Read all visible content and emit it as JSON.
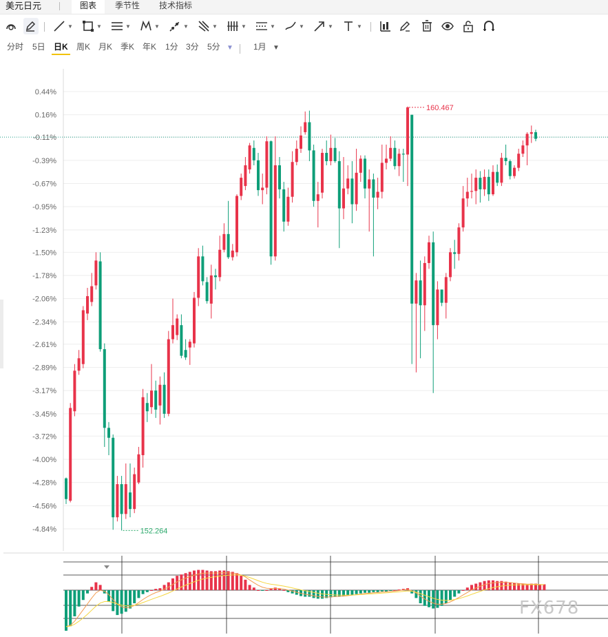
{
  "tabbar": {
    "title": "美元日元",
    "tabs": [
      {
        "label": "图表",
        "active": true
      },
      {
        "label": "季节性",
        "active": false
      },
      {
        "label": "技术指标",
        "active": false
      }
    ]
  },
  "toolbar": {
    "tools": [
      {
        "name": "magnet-icon",
        "caret": false
      },
      {
        "name": "pencil-icon",
        "caret": false,
        "active": true
      },
      {
        "name": "trend-line-icon",
        "caret": true
      },
      {
        "name": "rectangle-icon",
        "caret": true
      },
      {
        "name": "channel-icon",
        "caret": true
      },
      {
        "name": "pattern-icon",
        "caret": true
      },
      {
        "name": "ray-icon",
        "caret": true
      },
      {
        "name": "fork-icon",
        "caret": true
      },
      {
        "name": "bars-icon",
        "caret": true
      },
      {
        "name": "levels-icon",
        "caret": true
      },
      {
        "name": "brush-icon",
        "caret": true
      },
      {
        "name": "arrow-icon",
        "caret": true
      },
      {
        "name": "text-icon",
        "caret": true
      },
      {
        "name": "chart-icon",
        "caret": false
      },
      {
        "name": "edit-icon",
        "caret": false
      },
      {
        "name": "trash-icon",
        "caret": false
      },
      {
        "name": "eye-icon",
        "caret": false
      },
      {
        "name": "lock-icon",
        "caret": false
      },
      {
        "name": "magnet-u-icon",
        "caret": false
      }
    ]
  },
  "periods": {
    "items": [
      "分时",
      "5日",
      "日K",
      "周K",
      "月K",
      "季K",
      "年K",
      "1分",
      "3分",
      "5分"
    ],
    "active": "日K",
    "more_caret": "▼",
    "range_label": "1月",
    "range_caret": "▼"
  },
  "colors": {
    "up": "#e8334a",
    "down": "#0e9e78",
    "grid": "#eeeeee",
    "axis_text": "#666666",
    "last_price_line": "#1e9e86",
    "high_label": "#e8334a",
    "low_label": "#2aa86a",
    "macd_dif": "#f39c50",
    "macd_dea": "#f5d640"
  },
  "watermark": "FX678",
  "chart_data": {
    "type": "candlestick",
    "yaxis": {
      "unit": "%",
      "ticks": [
        "0.44%",
        "0.16%",
        "-0.11%",
        "-0.39%",
        "-0.67%",
        "-0.95%",
        "-1.23%",
        "-1.50%",
        "-1.78%",
        "-2.06%",
        "-2.34%",
        "-2.61%",
        "-2.89%",
        "-3.17%",
        "-3.45%",
        "-3.72%",
        "-4.00%",
        "-4.28%",
        "-4.56%",
        "-4.84%"
      ],
      "range": [
        -5.0,
        0.62
      ]
    },
    "last_value": -0.11,
    "annotations": {
      "high": {
        "label": "160.467",
        "value": 0.25,
        "index": 80
      },
      "low": {
        "label": "152.264",
        "value": -4.86,
        "index": 13
      }
    },
    "candles": [
      [
        -4.23,
        -4.48,
        -4.22,
        -4.54
      ],
      [
        -4.5,
        -3.38,
        -3.32,
        -4.52
      ],
      [
        -3.42,
        -2.93,
        -2.85,
        -3.48
      ],
      [
        -2.93,
        -2.78,
        -2.68,
        -2.98
      ],
      [
        -2.85,
        -2.2,
        -2.15,
        -2.9
      ],
      [
        -2.24,
        -2.03,
        -1.93,
        -2.32
      ],
      [
        -2.1,
        -1.91,
        -1.75,
        -2.15
      ],
      [
        -1.9,
        -1.6,
        -1.5,
        -1.95
      ],
      [
        -1.61,
        -2.67,
        -1.5,
        -2.7
      ],
      [
        -2.67,
        -3.62,
        -2.6,
        -3.85
      ],
      [
        -3.62,
        -3.74,
        -3.55,
        -3.95
      ],
      [
        -3.74,
        -4.7,
        -3.7,
        -4.85
      ],
      [
        -4.7,
        -4.3,
        -4.2,
        -4.75
      ],
      [
        -4.3,
        -4.66,
        -4.2,
        -4.86
      ],
      [
        -4.66,
        -4.3,
        -4.05,
        -4.72
      ],
      [
        -4.4,
        -4.6,
        -4.05,
        -4.7
      ],
      [
        -4.6,
        -4.18,
        -4.1,
        -4.65
      ],
      [
        -4.28,
        -3.94,
        -3.85,
        -4.3
      ],
      [
        -3.95,
        -3.25,
        -3.15,
        -4.1
      ],
      [
        -3.32,
        -3.42,
        -3.2,
        -3.55
      ],
      [
        -3.37,
        -3.17,
        -2.85,
        -3.45
      ],
      [
        -3.17,
        -3.4,
        -3.05,
        -3.5
      ],
      [
        -3.35,
        -3.1,
        -3.0,
        -3.58
      ],
      [
        -3.1,
        -3.45,
        -2.95,
        -3.5
      ],
      [
        -3.45,
        -2.55,
        -2.45,
        -3.48
      ],
      [
        -2.55,
        -2.38,
        -2.06,
        -2.6
      ],
      [
        -2.5,
        -2.3,
        -2.25,
        -2.56
      ],
      [
        -2.38,
        -2.75,
        -2.25,
        -2.78
      ],
      [
        -2.68,
        -2.77,
        -2.55,
        -2.8
      ],
      [
        -2.65,
        -2.58,
        -2.55,
        -2.86
      ],
      [
        -2.6,
        -2.05,
        -1.98,
        -2.65
      ],
      [
        -2.05,
        -1.55,
        -1.45,
        -2.15
      ],
      [
        -1.55,
        -1.85,
        -1.42,
        -1.9
      ],
      [
        -1.86,
        -2.09,
        -1.8,
        -2.12
      ],
      [
        -2.12,
        -1.78,
        -1.65,
        -2.3
      ],
      [
        -1.78,
        -1.8,
        -1.7,
        -1.95
      ],
      [
        -1.8,
        -1.47,
        -1.3,
        -1.85
      ],
      [
        -1.47,
        -1.28,
        -1.15,
        -1.5
      ],
      [
        -1.28,
        -1.56,
        -0.88,
        -1.58
      ],
      [
        -1.56,
        -1.48,
        -1.4,
        -1.6
      ],
      [
        -1.5,
        -0.82,
        -0.8,
        -1.55
      ],
      [
        -0.82,
        -0.6,
        -0.55,
        -0.87
      ],
      [
        -0.7,
        -0.45,
        -0.35,
        -0.75
      ],
      [
        -0.5,
        -0.21,
        -0.18,
        -0.55
      ],
      [
        -0.24,
        -0.39,
        -0.15,
        -0.45
      ],
      [
        -0.39,
        -0.75,
        -0.3,
        -0.82
      ],
      [
        -0.75,
        -0.72,
        -0.55,
        -0.92
      ],
      [
        -0.72,
        -0.16,
        -0.1,
        -0.8
      ],
      [
        -0.16,
        -1.55,
        -0.15,
        -1.65
      ],
      [
        -1.55,
        -0.45,
        -0.1,
        -1.6
      ],
      [
        -0.45,
        -0.74,
        -0.35,
        -0.85
      ],
      [
        -0.74,
        -1.13,
        -0.65,
        -1.25
      ],
      [
        -1.13,
        -0.83,
        -0.72,
        -1.18
      ],
      [
        -0.83,
        -0.41,
        -0.28,
        -0.9
      ],
      [
        -0.41,
        -0.25,
        -0.15,
        -0.45
      ],
      [
        -0.25,
        -0.09,
        0.02,
        -0.3
      ],
      [
        -0.05,
        0.07,
        0.2,
        -0.08
      ],
      [
        0.07,
        -0.27,
        0.21,
        -0.4
      ],
      [
        -0.27,
        -0.88,
        -0.2,
        -0.95
      ],
      [
        -0.88,
        -0.8,
        -0.65,
        -1.2
      ],
      [
        -0.78,
        -0.3,
        -0.25,
        -0.85
      ],
      [
        -0.3,
        -0.4,
        -0.15,
        -0.45
      ],
      [
        -0.4,
        -0.24,
        -0.08,
        -0.45
      ],
      [
        -0.24,
        -0.4,
        -0.12,
        -0.42
      ],
      [
        -0.4,
        -0.97,
        -0.28,
        -1.45
      ],
      [
        -0.97,
        -0.73,
        -0.35,
        -1.1
      ],
      [
        -0.73,
        -0.61,
        -0.45,
        -0.8
      ],
      [
        -0.61,
        -0.92,
        -0.4,
        -1.15
      ],
      [
        -0.92,
        -0.54,
        -0.25,
        -1.0
      ],
      [
        -0.54,
        -0.37,
        -0.33,
        -0.65
      ],
      [
        -0.37,
        -0.73,
        -0.33,
        -0.85
      ],
      [
        -0.73,
        -0.62,
        -0.5,
        -1.25
      ],
      [
        -0.62,
        -0.84,
        -0.55,
        -1.55
      ],
      [
        -0.84,
        -0.77,
        -0.6,
        -0.98
      ],
      [
        -0.77,
        -0.42,
        -0.2,
        -0.85
      ],
      [
        -0.42,
        -0.37,
        -0.2,
        -0.5
      ],
      [
        -0.37,
        -0.24,
        -0.1,
        -0.4
      ],
      [
        -0.24,
        -0.46,
        -0.15,
        -0.5
      ],
      [
        -0.46,
        -0.31,
        -0.25,
        -0.58
      ],
      [
        -0.31,
        -0.32,
        -0.25,
        -0.65
      ],
      [
        -0.32,
        0.25,
        0.26,
        -0.7
      ],
      [
        0.16,
        -2.12,
        0.16,
        -2.85
      ],
      [
        -2.12,
        -1.84,
        -1.75,
        -2.95
      ],
      [
        -1.84,
        -2.14,
        -1.6,
        -2.78
      ],
      [
        -2.14,
        -1.63,
        -1.55,
        -2.45
      ],
      [
        -1.63,
        -1.38,
        -1.3,
        -1.7
      ],
      [
        -1.38,
        -2.38,
        -1.25,
        -3.2
      ],
      [
        -2.38,
        -1.95,
        -1.85,
        -2.55
      ],
      [
        -1.95,
        -2.11,
        -1.95,
        -2.15
      ],
      [
        -2.11,
        -1.8,
        -1.75,
        -2.3
      ],
      [
        -1.8,
        -1.5,
        -1.45,
        -1.85
      ],
      [
        -1.5,
        -1.52,
        -1.35,
        -1.7
      ],
      [
        -1.52,
        -1.2,
        -1.15,
        -1.6
      ],
      [
        -1.2,
        -0.85,
        -0.7,
        -1.25
      ],
      [
        -0.85,
        -0.77,
        -0.6,
        -0.95
      ],
      [
        -0.77,
        -0.76,
        -0.55,
        -0.85
      ],
      [
        -0.76,
        -0.6,
        -0.5,
        -0.92
      ],
      [
        -0.6,
        -0.74,
        -0.52,
        -0.9
      ],
      [
        -0.74,
        -0.59,
        -0.5,
        -0.82
      ],
      [
        -0.59,
        -0.8,
        -0.5,
        -0.88
      ],
      [
        -0.8,
        -0.53,
        -0.45,
        -0.82
      ],
      [
        -0.53,
        -0.66,
        -0.44,
        -0.7
      ],
      [
        -0.66,
        -0.36,
        -0.3,
        -0.7
      ],
      [
        -0.36,
        -0.4,
        -0.2,
        -0.45
      ],
      [
        -0.4,
        -0.58,
        -0.38,
        -0.62
      ],
      [
        -0.58,
        -0.48,
        -0.45,
        -0.61
      ],
      [
        -0.48,
        -0.31,
        -0.25,
        -0.52
      ],
      [
        -0.31,
        -0.21,
        -0.15,
        -0.35
      ],
      [
        -0.21,
        -0.07,
        -0.05,
        -0.45
      ],
      [
        -0.07,
        -0.05,
        0.03,
        -0.18
      ],
      [
        -0.05,
        -0.13,
        -0.02,
        -0.16
      ]
    ],
    "macd": [
      -0.62,
      -0.55,
      -0.4,
      -0.25,
      -0.15,
      -0.05,
      0.05,
      0.12,
      0.08,
      -0.05,
      -0.18,
      -0.32,
      -0.38,
      -0.36,
      -0.33,
      -0.28,
      -0.2,
      -0.12,
      -0.06,
      -0.03,
      0.0,
      0.02,
      0.03,
      0.08,
      0.12,
      0.18,
      0.22,
      0.24,
      0.26,
      0.28,
      0.3,
      0.31,
      0.31,
      0.3,
      0.29,
      0.29,
      0.3,
      0.3,
      0.29,
      0.28,
      0.26,
      0.22,
      0.16,
      0.08,
      0.04,
      0.0,
      -0.01,
      0.0,
      0.02,
      0.04,
      0.02,
      0.0,
      -0.03,
      -0.05,
      -0.07,
      -0.09,
      -0.1,
      -0.1,
      -0.12,
      -0.13,
      -0.13,
      -0.12,
      -0.11,
      -0.1,
      -0.1,
      -0.09,
      -0.08,
      -0.07,
      -0.06,
      -0.05,
      -0.04,
      -0.04,
      -0.03,
      -0.03,
      -0.02,
      -0.02,
      -0.01,
      0.0,
      0.01,
      0.02,
      0.03,
      -0.05,
      -0.12,
      -0.2,
      -0.24,
      -0.26,
      -0.28,
      -0.27,
      -0.24,
      -0.2,
      -0.15,
      -0.1,
      -0.05,
      0.0,
      0.04,
      0.08,
      0.1,
      0.12,
      0.14,
      0.15,
      0.15,
      0.14,
      0.14,
      0.13,
      0.12,
      0.11,
      0.1,
      0.1,
      0.09,
      0.1,
      0.1,
      0.09,
      0.09
    ]
  }
}
